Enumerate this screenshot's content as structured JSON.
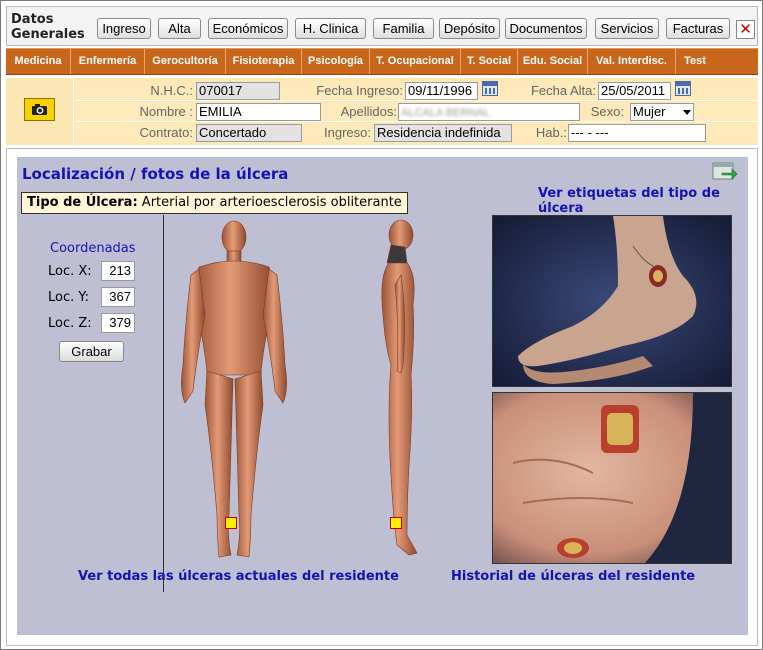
{
  "toolbar": {
    "title": "Datos Generales",
    "buttons": [
      "Ingreso",
      "Alta",
      "Económicos",
      "H. Clinica",
      "Familia",
      "Depósito",
      "Documentos",
      "Servicios",
      "Facturas"
    ],
    "close_label": "✕"
  },
  "menu": [
    "Medicina",
    "Enfermería",
    "Gerocultoría",
    "Fisioterapia",
    "Psicología",
    "T. Ocupacional",
    "T. Social",
    "Edu. Social",
    "Val. Interdisc.",
    "Test"
  ],
  "patient": {
    "nhc_label": "N.H.C.:",
    "nhc_value": "070017",
    "fecha_ingreso_label": "Fecha Ingreso:",
    "fecha_ingreso_value": "09/11/1996",
    "fecha_alta_label": "Fecha Alta:",
    "fecha_alta_value": "25/05/2011",
    "nombre_label": "Nombre :",
    "nombre_value": "EMILIA",
    "apellidos_label": "Apellidos:",
    "apellidos_value": "ALCALA BERNAL",
    "sexo_label": "Sexo:",
    "sexo_value": "Mujer",
    "contrato_label": "Contrato:",
    "contrato_value": "Concertado",
    "ingreso_label": "Ingreso:",
    "ingreso_value": "Residencia indefinida",
    "hab_label": "Hab.:",
    "hab_value": "--- - ---"
  },
  "panel": {
    "title": "Localización / fotos de la úlcera",
    "etiquetas_link": "Ver etiquetas del tipo de úlcera",
    "tipo_label": "Tipo de Úlcera:",
    "tipo_value": "Arterial por arterioesclerosis obliterante",
    "coords_title": "Coordenadas",
    "loc_x_label": "Loc. X:",
    "loc_x_value": "213",
    "loc_y_label": "Loc. Y:",
    "loc_y_value": "367",
    "loc_z_label": "Loc. Z:",
    "loc_z_value": "379",
    "grabar_label": "Grabar",
    "ver_todas_link": "Ver todas las úlceras actuales del residente",
    "historial_link": "Historial de úlceras del residente"
  },
  "colors": {
    "menu_bg": "#c8661c",
    "header_bg": "#fbe6b4",
    "panel_bg": "#bfbfd3",
    "link": "#1414b4",
    "marker": "#ffee00"
  }
}
